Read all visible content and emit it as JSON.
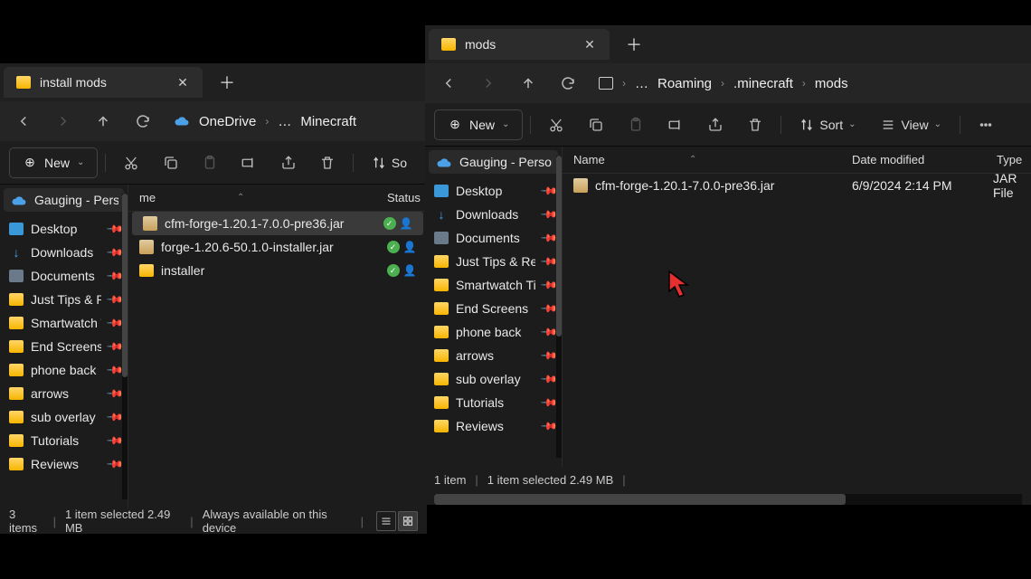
{
  "w1": {
    "title": "install mods",
    "crumb_seg1": "OneDrive",
    "crumb_dots": "…",
    "crumb_seg2": "Minecraft",
    "new_label": "New",
    "sort_label": "So",
    "side_hdr": "Gauging - Persona",
    "side": [
      "Desktop",
      "Downloads",
      "Documents",
      "Just Tips & Rev",
      "Smartwatch Tip",
      "End Screens",
      "phone back",
      "arrows",
      "sub overlay",
      "Tutorials",
      "Reviews"
    ],
    "col_name": "me",
    "col_status": "Status",
    "rows": [
      {
        "name": "cfm-forge-1.20.1-7.0.0-pre36.jar",
        "type": "jar"
      },
      {
        "name": "forge-1.20.6-50.1.0-installer.jar",
        "type": "jar"
      },
      {
        "name": "installer",
        "type": "folder"
      }
    ],
    "status_a": "3 items",
    "status_b": "1 item selected  2.49 MB",
    "status_c": "Always available on this device"
  },
  "w2": {
    "title": "mods",
    "crumb": [
      "Roaming",
      ".minecraft",
      "mods"
    ],
    "new_label": "New",
    "sort_label": "Sort",
    "view_label": "View",
    "side_hdr": "Gauging - Persona",
    "side": [
      "Desktop",
      "Downloads",
      "Documents",
      "Just Tips & Rev",
      "Smartwatch Tip",
      "End Screens",
      "phone back",
      "arrows",
      "sub overlay",
      "Tutorials",
      "Reviews"
    ],
    "col_name": "Name",
    "col_date": "Date modified",
    "col_type": "Type",
    "r0_name": "cfm-forge-1.20.1-7.0.0-pre36.jar",
    "r0_date": "6/9/2024 2:14 PM",
    "r0_type": "JAR File",
    "status_a": "1 item",
    "status_b": "1 item selected  2.49 MB"
  }
}
